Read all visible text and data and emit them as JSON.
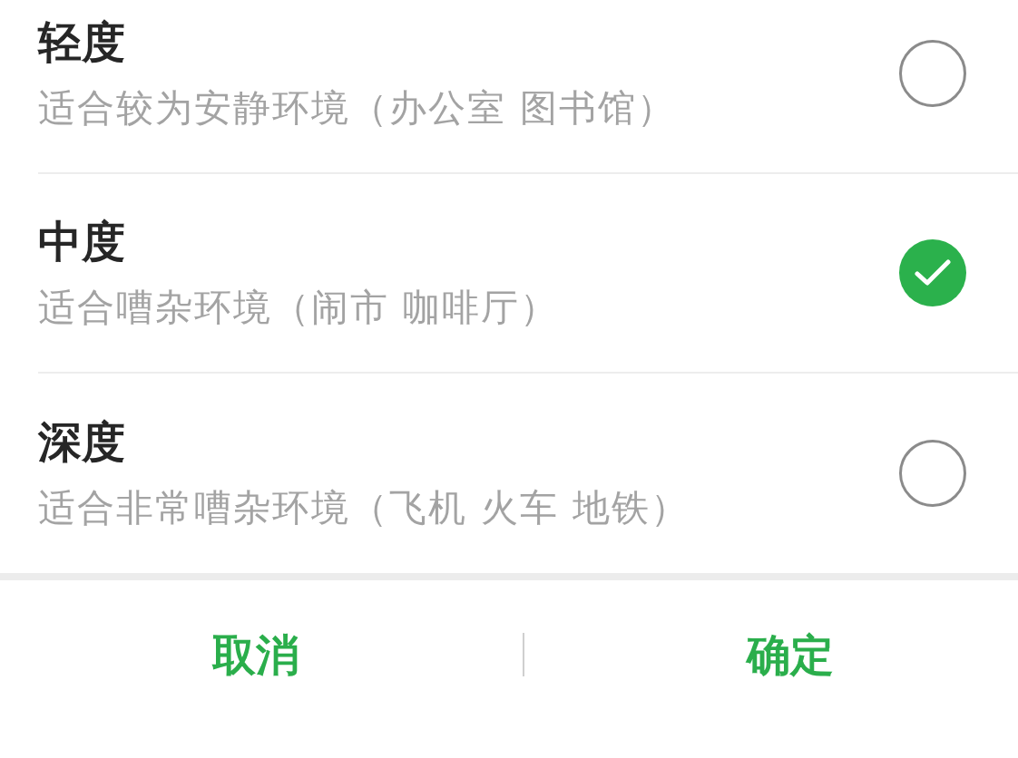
{
  "options": [
    {
      "title": "轻度",
      "description": "适合较为安静环境（办公室 图书馆）",
      "selected": false
    },
    {
      "title": "中度",
      "description": "适合嘈杂环境（闹市 咖啡厅）",
      "selected": true
    },
    {
      "title": "深度",
      "description": "适合非常嘈杂环境（飞机 火车 地铁）",
      "selected": false
    }
  ],
  "buttons": [
    "取消",
    "确定"
  ]
}
